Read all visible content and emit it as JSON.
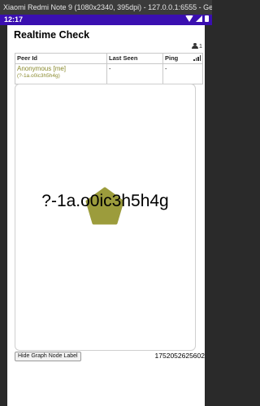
{
  "window": {
    "title": "Xiaomi Redmi Note 9 (1080x2340, 395dpi) - 127.0.0.1:6555 - Genymotion"
  },
  "status_bar": {
    "time": "12:17",
    "background": "#3a0fb0"
  },
  "app": {
    "title": "Realtime Check",
    "peer_count": "1",
    "peer_count_icon": "users-icon",
    "table": {
      "headers": {
        "peer_id": "Peer Id",
        "last_seen": "Last Seen",
        "ping": "Ping",
        "ping_icon": "signal-bars-icon"
      },
      "rows": [
        {
          "name": "Anonymous [me]",
          "id": "(?-1a.o0ic3h5h4g)",
          "last_seen": "-",
          "ping": "-"
        }
      ]
    },
    "graph": {
      "node_label": "?-1a.o0ic3h5h4g",
      "node_color": "#9c9c3c",
      "node_shape": "pentagon"
    },
    "hide_label_button": "Hide Graph Node Label",
    "timestamp": "1752052625602",
    "accent_color": "#8a8a2e"
  }
}
